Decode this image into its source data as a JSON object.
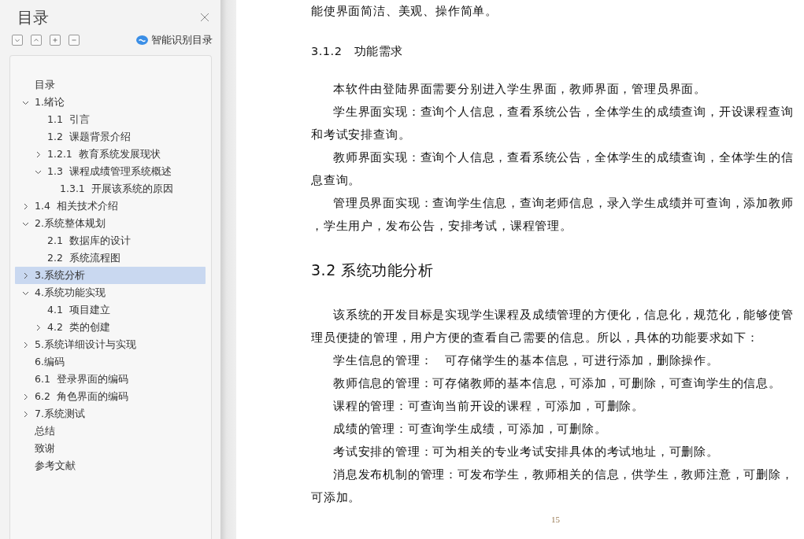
{
  "sidebar": {
    "title": "目录",
    "toolbar": [
      {
        "kind": "collapse-all"
      },
      {
        "kind": "expand-all"
      },
      {
        "kind": "add"
      },
      {
        "kind": "remove"
      }
    ],
    "smart_button": "智能识别目录",
    "toc": [
      {
        "label": "目录",
        "selected": false
      },
      {
        "label": "1.绪论",
        "selected": false,
        "expanded": true,
        "children": [
          {
            "label": "1.1  引言",
            "selected": false
          },
          {
            "label": "1.2  课题背景介绍",
            "selected": false
          },
          {
            "label": "1.2.1  教育系统发展现状",
            "selected": false,
            "expanded": false
          },
          {
            "label": "1.3  课程成绩管理系统概述",
            "selected": false,
            "expanded": true,
            "children": [
              {
                "label": "1.3.1  开展该系统的原因",
                "selected": false
              }
            ]
          }
        ]
      },
      {
        "label": "1.4  相关技术介绍",
        "selected": false,
        "expanded": false
      },
      {
        "label": "2.系统整体规划",
        "selected": false,
        "expanded": true,
        "children": [
          {
            "label": "2.1  数据库的设计",
            "selected": false
          },
          {
            "label": "2.2  系统流程图",
            "selected": false
          }
        ]
      },
      {
        "label": "3.系统分析",
        "selected": true,
        "expanded": false
      },
      {
        "label": "4.系统功能实现",
        "selected": false,
        "expanded": true,
        "children": [
          {
            "label": "4.1  项目建立",
            "selected": false
          },
          {
            "label": "4.2  类的创建",
            "selected": false,
            "expanded": false
          }
        ]
      },
      {
        "label": "5.系统详细设计与实现",
        "selected": false,
        "expanded": false
      },
      {
        "label": "6.编码",
        "selected": false
      },
      {
        "label": "6.1  登录界面的编码",
        "selected": false
      },
      {
        "label": "6.2  角色界面的编码",
        "selected": false,
        "expanded": false
      },
      {
        "label": "7.系统测试",
        "selected": false,
        "expanded": false
      },
      {
        "label": "总结",
        "selected": false
      },
      {
        "label": "致谢",
        "selected": false
      },
      {
        "label": "参考文献",
        "selected": false
      }
    ]
  },
  "document": {
    "blocks": [
      {
        "kind": "continuation",
        "text": "能使界面简洁、美观、操作简单。"
      },
      {
        "kind": "subheading",
        "text": "3.1.2　功能需求"
      },
      {
        "kind": "paragraph",
        "text": "本软件由登陆界面需要分别进入学生界面，教师界面，管理员界面。"
      },
      {
        "kind": "paragraph",
        "text": "学生界面实现：查询个人信息，查看系统公告，全体学生的成绩查询，开设课程查询和考试安排查询。"
      },
      {
        "kind": "paragraph",
        "text": "教师界面实现：查询个人信息，查看系统公告，全体学生的成绩查询，全体学生的信息查询。"
      },
      {
        "kind": "paragraph",
        "text": "管理员界面实现：查询学生信息，查询老师信息，录入学生成绩并可查询，添加教师，学生用户，发布公告，安排考试，课程管理。"
      },
      {
        "kind": "heading",
        "text": "3.2 系统功能分析"
      },
      {
        "kind": "paragraph",
        "text": "该系统的开发目标是实现学生课程及成绩管理的方便化，信息化，规范化，能够使管理员便捷的管理，用户方便的查看自己需要的信息。所以，具体的功能要求如下："
      },
      {
        "kind": "paragraph",
        "text": "学生信息的管理：　可存储学生的基本信息，可进行添加，删除操作。"
      },
      {
        "kind": "paragraph",
        "text": "教师信息的管理：可存储教师的基本信息，可添加，可删除，可查询学生的信息。"
      },
      {
        "kind": "paragraph",
        "text": "课程的管理：可查询当前开设的课程，可添加，可删除。"
      },
      {
        "kind": "paragraph",
        "text": "成绩的管理：可查询学生成绩，可添加，可删除。"
      },
      {
        "kind": "paragraph",
        "text": "考试安排的管理：可为相关的专业考试安排具体的考试地址，可删除。"
      },
      {
        "kind": "paragraph",
        "text": "消息发布机制的管理：可发布学生，教师相关的信息，供学生，教师注意，可删除，可添加。"
      }
    ],
    "page_number": "15"
  }
}
